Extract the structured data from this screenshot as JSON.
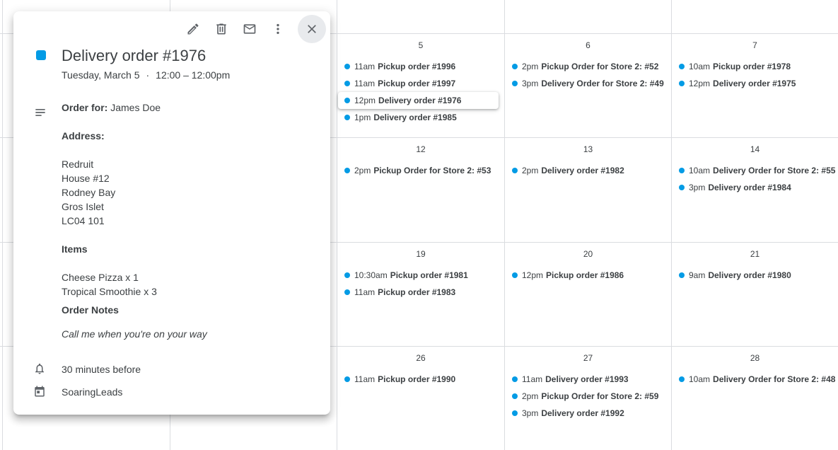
{
  "calendar": {
    "cells": [
      {
        "day": "5",
        "events": [
          {
            "time": "11am",
            "title": "Pickup order #1996"
          },
          {
            "time": "11am",
            "title": "Pickup order #1997"
          },
          {
            "time": "12pm",
            "title": "Delivery order #1976",
            "selected": true
          },
          {
            "time": "1pm",
            "title": "Delivery order #1985"
          }
        ]
      },
      {
        "day": "6",
        "events": [
          {
            "time": "2pm",
            "title": "Pickup Order for Store 2: #52"
          },
          {
            "time": "3pm",
            "title": "Delivery Order for Store 2: #49"
          }
        ]
      },
      {
        "day": "7",
        "events": [
          {
            "time": "10am",
            "title": "Pickup order #1978"
          },
          {
            "time": "12pm",
            "title": "Delivery order #1975"
          }
        ]
      },
      {
        "day": "12",
        "events": [
          {
            "time": "2pm",
            "title": "Pickup Order for Store 2: #53"
          }
        ]
      },
      {
        "day": "13",
        "events": [
          {
            "time": "2pm",
            "title": "Delivery order #1982"
          }
        ]
      },
      {
        "day": "14",
        "events": [
          {
            "time": "10am",
            "title": "Delivery Order for Store 2: #55"
          },
          {
            "time": "3pm",
            "title": "Delivery order #1984"
          }
        ]
      },
      {
        "day": "19",
        "events": [
          {
            "time": "10:30am",
            "title": "Pickup order #1981"
          },
          {
            "time": "11am",
            "title": "Pickup order #1983"
          }
        ]
      },
      {
        "day": "20",
        "events": [
          {
            "time": "12pm",
            "title": "Pickup order #1986"
          }
        ]
      },
      {
        "day": "21",
        "events": [
          {
            "time": "9am",
            "title": "Delivery order #1980"
          }
        ]
      },
      {
        "day": "26",
        "events": [
          {
            "time": "11am",
            "title": "Pickup order #1990"
          }
        ]
      },
      {
        "day": "27",
        "events": [
          {
            "time": "11am",
            "title": "Delivery order #1993"
          },
          {
            "time": "2pm",
            "title": "Pickup Order for Store 2: #59"
          },
          {
            "time": "3pm",
            "title": "Delivery order #1992"
          }
        ]
      },
      {
        "day": "28",
        "events": [
          {
            "time": "10am",
            "title": "Delivery Order for Store 2: #48"
          }
        ]
      }
    ]
  },
  "popup": {
    "toolbar_icons": [
      "pencil-icon",
      "trash-icon",
      "mail-icon",
      "more-vert-icon",
      "close-icon"
    ],
    "event_color": "#039be5",
    "title": "Delivery order #1976",
    "date": "Tuesday, March 5",
    "separator": "·",
    "time_range": "12:00 – 12:00pm",
    "description": {
      "order_for_label": "Order for:",
      "order_for_value": "James Doe",
      "address_label": "Address:",
      "address_lines": [
        "Redruit",
        "House #12",
        "Rodney Bay",
        "Gros Islet",
        "LC04 101"
      ],
      "items_label": "Items",
      "items": [
        "Cheese Pizza x 1",
        "Tropical Smoothie x 3"
      ],
      "notes_label": "Order Notes",
      "notes": "Call me when you're on your way"
    },
    "reminder": "30 minutes before",
    "calendar_name": "SoaringLeads"
  },
  "colors": {
    "event_dot": "#039be5",
    "grid_line": "#dadce0",
    "close_button_bg": "#e8eaed"
  }
}
